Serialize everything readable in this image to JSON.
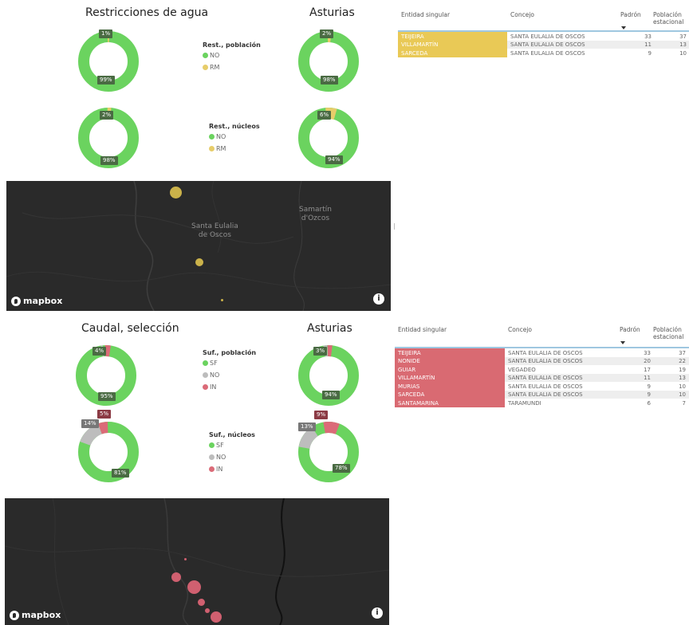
{
  "top": {
    "title_left": "Restricciones de agua",
    "title_right": "Asturias",
    "donut1_left": {
      "a": "1%",
      "b": "99%",
      "pct_a": 1
    },
    "donut1_right": {
      "a": "2%",
      "b": "98%",
      "pct_a": 2
    },
    "donut2_left": {
      "a": "2%",
      "b": "98%",
      "pct_a": 2
    },
    "donut2_right": {
      "a": "6%",
      "b": "94%",
      "pct_a": 6
    },
    "legend1": {
      "title": "Rest., población",
      "items": [
        "NO",
        "RM"
      ]
    },
    "legend2": {
      "title": "Rest., núcleos",
      "items": [
        "NO",
        "RM"
      ]
    },
    "map": {
      "places": [
        "Santa Eulalia\nde Oscos",
        "Samartín\nd'Ozcos"
      ],
      "brand": "mapbox",
      "info": "i"
    },
    "table": {
      "headers": {
        "entidad": "Entidad singular",
        "concejo": "Concejo",
        "padron": "Padrón",
        "poblacion": "Población\nestacional"
      },
      "rows": [
        {
          "entidad": "TEIJEIRA",
          "concejo": "SANTA EULALIA DE OSCOS",
          "padron": "33",
          "poblacion": "37"
        },
        {
          "entidad": "VILLAMARTÍN",
          "concejo": "SANTA EULALIA DE OSCOS",
          "padron": "11",
          "poblacion": "13"
        },
        {
          "entidad": "SARCEDA",
          "concejo": "SANTA EULALIA DE OSCOS",
          "padron": "9",
          "poblacion": "10"
        }
      ]
    }
  },
  "bottom": {
    "title_left": "Caudal, selección",
    "title_right": "Asturias",
    "donut1_left": {
      "a": "4%",
      "b": "95%"
    },
    "donut1_right": {
      "a": "3%",
      "b": "94%"
    },
    "donut2_left": {
      "a": "5%",
      "b": "14%",
      "c": "81%"
    },
    "donut2_right": {
      "a": "9%",
      "b": "13%",
      "c": "78%"
    },
    "legend1": {
      "title": "Suf., población",
      "items": [
        "SF",
        "NO",
        "IN"
      ]
    },
    "legend2": {
      "title": "Suf., núcleos",
      "items": [
        "SF",
        "NO",
        "IN"
      ]
    },
    "map": {
      "brand": "mapbox",
      "info": "i"
    },
    "table": {
      "headers": {
        "entidad": "Entidad singular",
        "concejo": "Concejo",
        "padron": "Padrón",
        "poblacion": "Población\nestacional"
      },
      "rows": [
        {
          "entidad": "TEIJEIRA",
          "concejo": "SANTA EULALIA DE OSCOS",
          "padron": "33",
          "poblacion": "37"
        },
        {
          "entidad": "NONIDE",
          "concejo": "SANTA EULALIA DE OSCOS",
          "padron": "20",
          "poblacion": "22"
        },
        {
          "entidad": "GUIAR",
          "concejo": "VEGADEO",
          "padron": "17",
          "poblacion": "19"
        },
        {
          "entidad": "VILLAMARTÍN",
          "concejo": "SANTA EULALIA DE OSCOS",
          "padron": "11",
          "poblacion": "13"
        },
        {
          "entidad": "MURIAS",
          "concejo": "SANTA EULALIA DE OSCOS",
          "padron": "9",
          "poblacion": "10"
        },
        {
          "entidad": "SARCEDA",
          "concejo": "SANTA EULALIA DE OSCOS",
          "padron": "9",
          "poblacion": "10"
        },
        {
          "entidad": "SANTAMARINA",
          "concejo": "TARAMUNDI",
          "padron": "6",
          "poblacion": "7"
        }
      ]
    }
  },
  "colors": {
    "green": "#6bd35f",
    "yellow": "#e7cd6a",
    "grey": "#bdbdbd",
    "red": "#db6b78",
    "highlight_yellow": "#e9c956",
    "highlight_red": "#d96a72"
  }
}
